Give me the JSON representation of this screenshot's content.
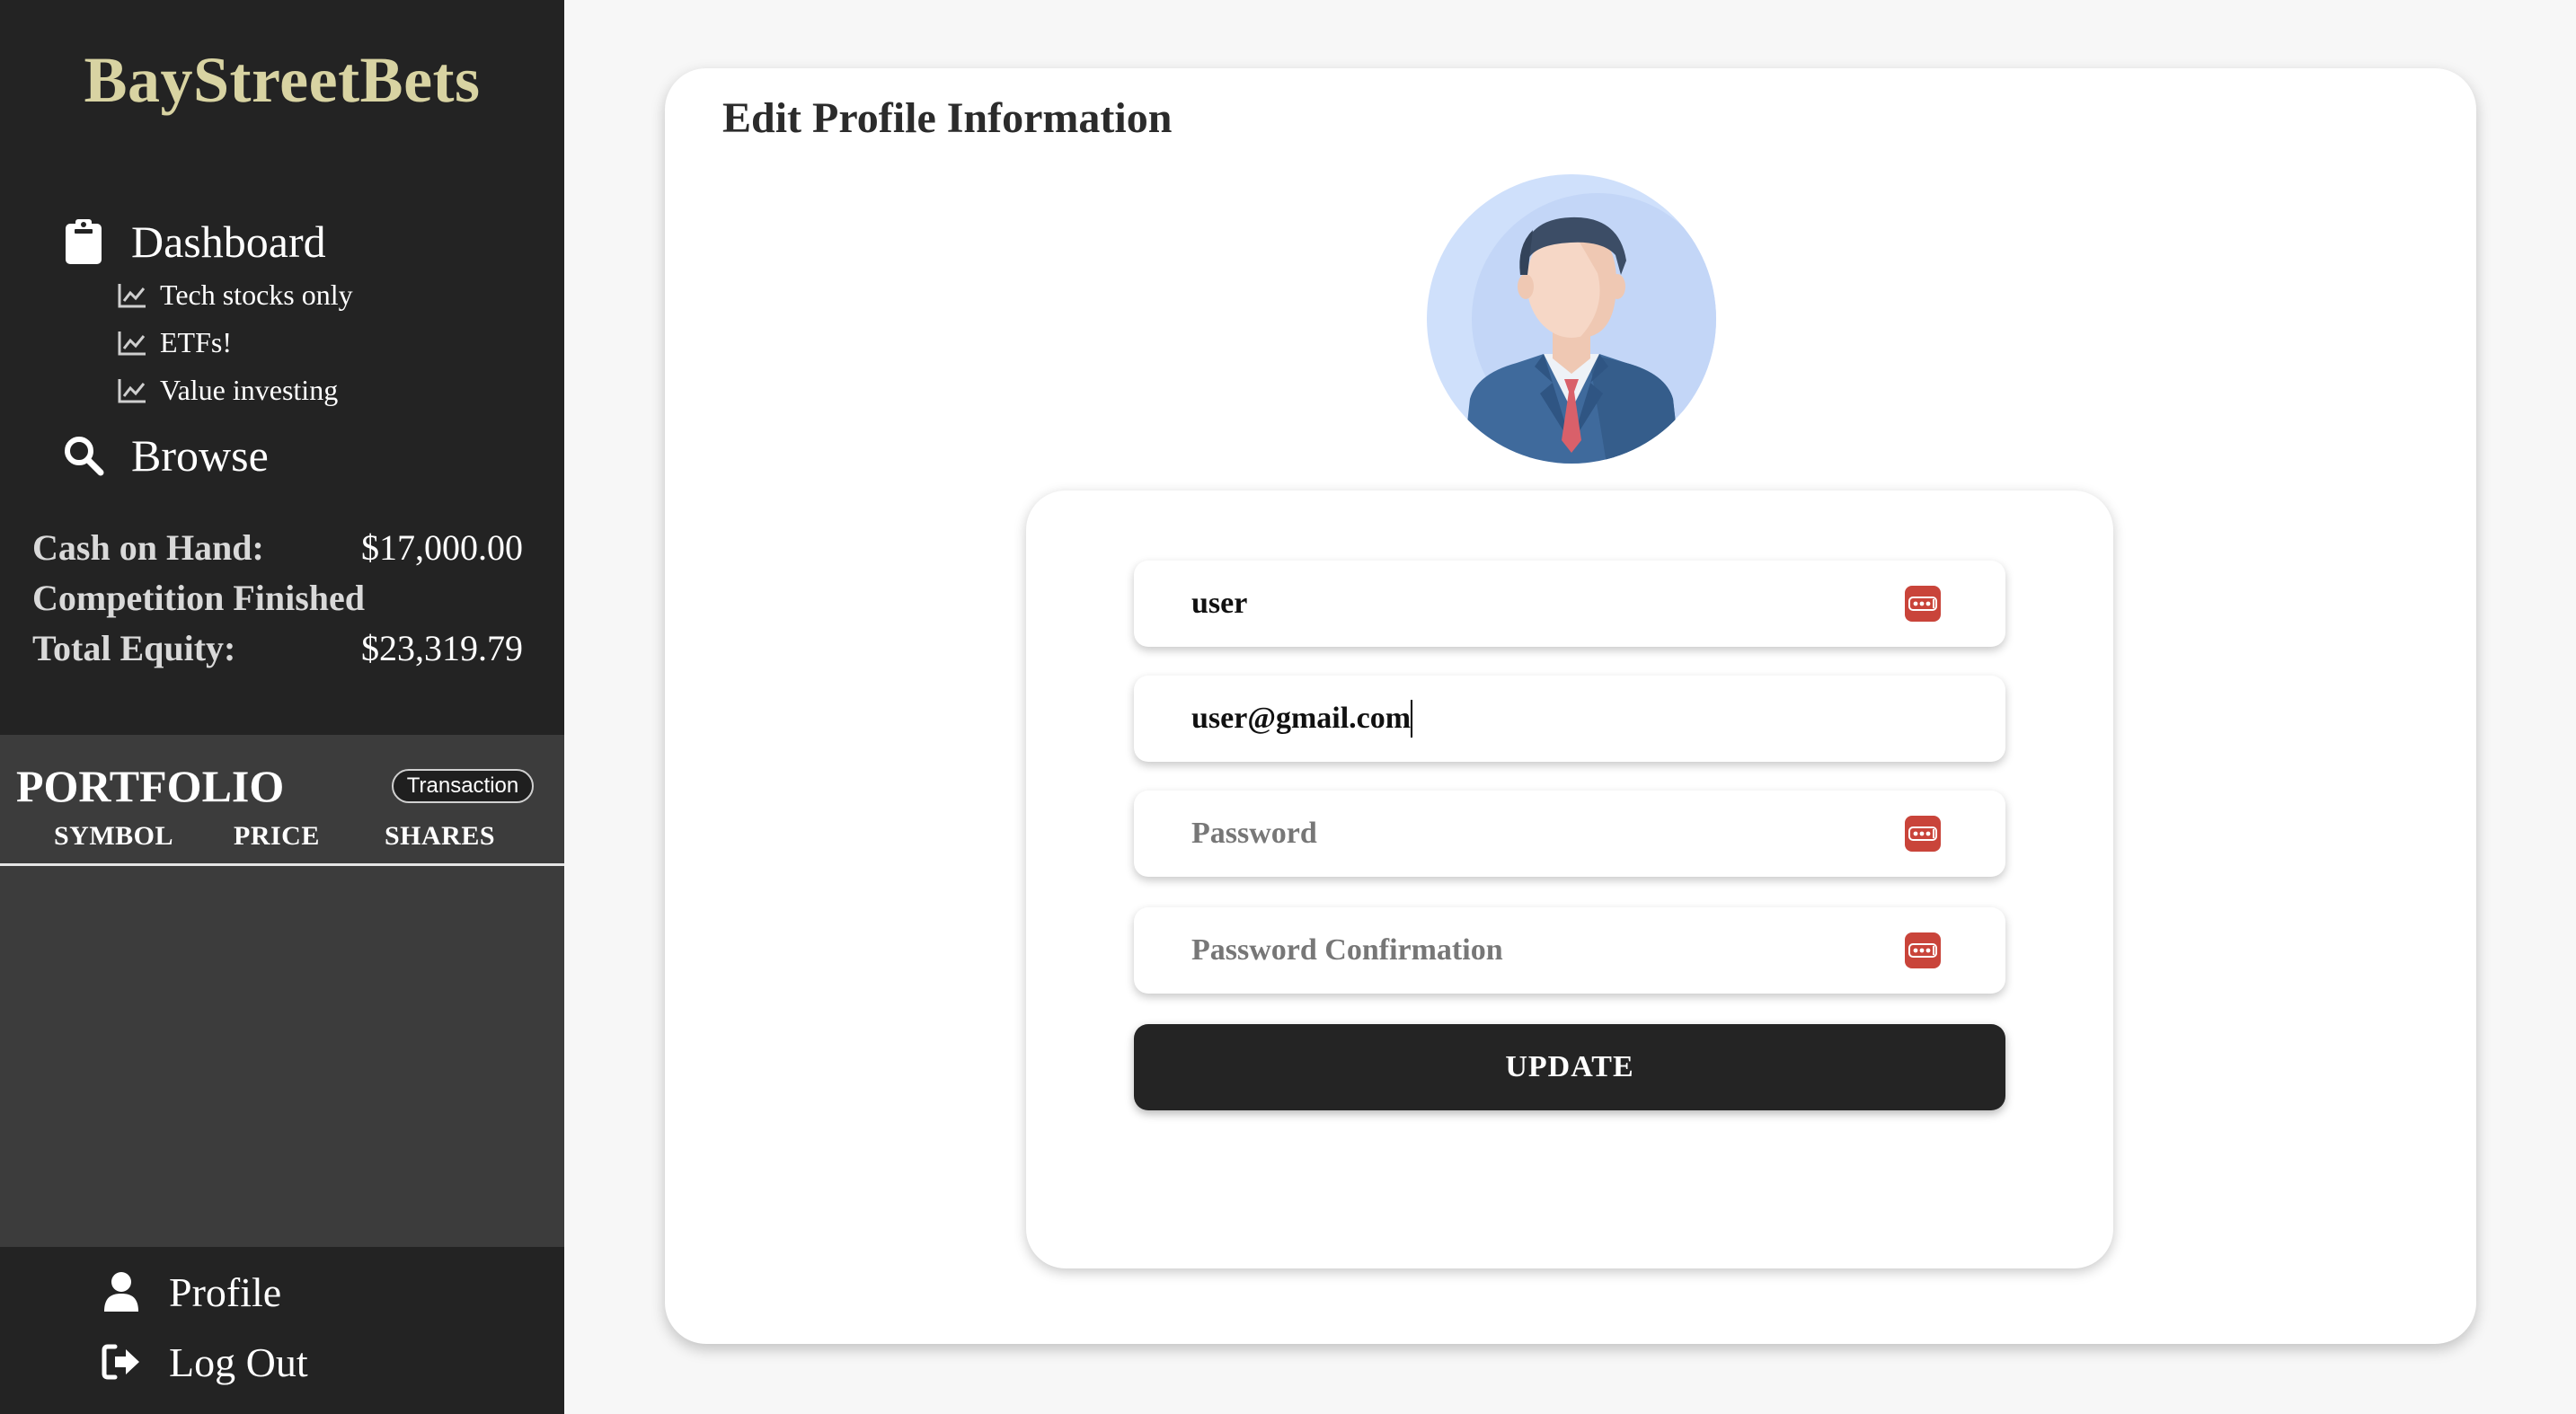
{
  "app": {
    "title": "BayStreetBets",
    "brand_color": "#d8d3a2"
  },
  "sidebar": {
    "dashboard_label": "Dashboard",
    "watchlists": [
      {
        "label": "Tech stocks only"
      },
      {
        "label": "ETFs!"
      },
      {
        "label": "Value investing"
      }
    ],
    "browse_label": "Browse",
    "stats": {
      "cash_label": "Cash on Hand:",
      "cash_value": "$17,000.00",
      "status_text": "Competition Finished",
      "equity_label": "Total Equity:",
      "equity_value": "$23,319.79"
    },
    "portfolio": {
      "title": "PORTFOLIO",
      "transaction_button": "Transaction",
      "columns": [
        "SYMBOL",
        "PRICE",
        "SHARES"
      ],
      "rows": []
    },
    "profile_label": "Profile",
    "logout_label": "Log Out",
    "icons": {
      "dashboard": "clipboard-icon",
      "watchlist": "line-chart-icon",
      "browse": "search-icon",
      "profile": "user-icon",
      "logout": "sign-out-icon"
    }
  },
  "main": {
    "title": "Edit Profile Information",
    "avatar": "businessman-avatar-icon",
    "form": {
      "username_value": "user",
      "email_value": "user@gmail.com",
      "password_placeholder": "Password",
      "password_confirmation_placeholder": "Password Confirmation",
      "update_label": "UPDATE",
      "password_manager_icon": "password-manager-icon",
      "password_manager_color": "#c9443a"
    }
  }
}
